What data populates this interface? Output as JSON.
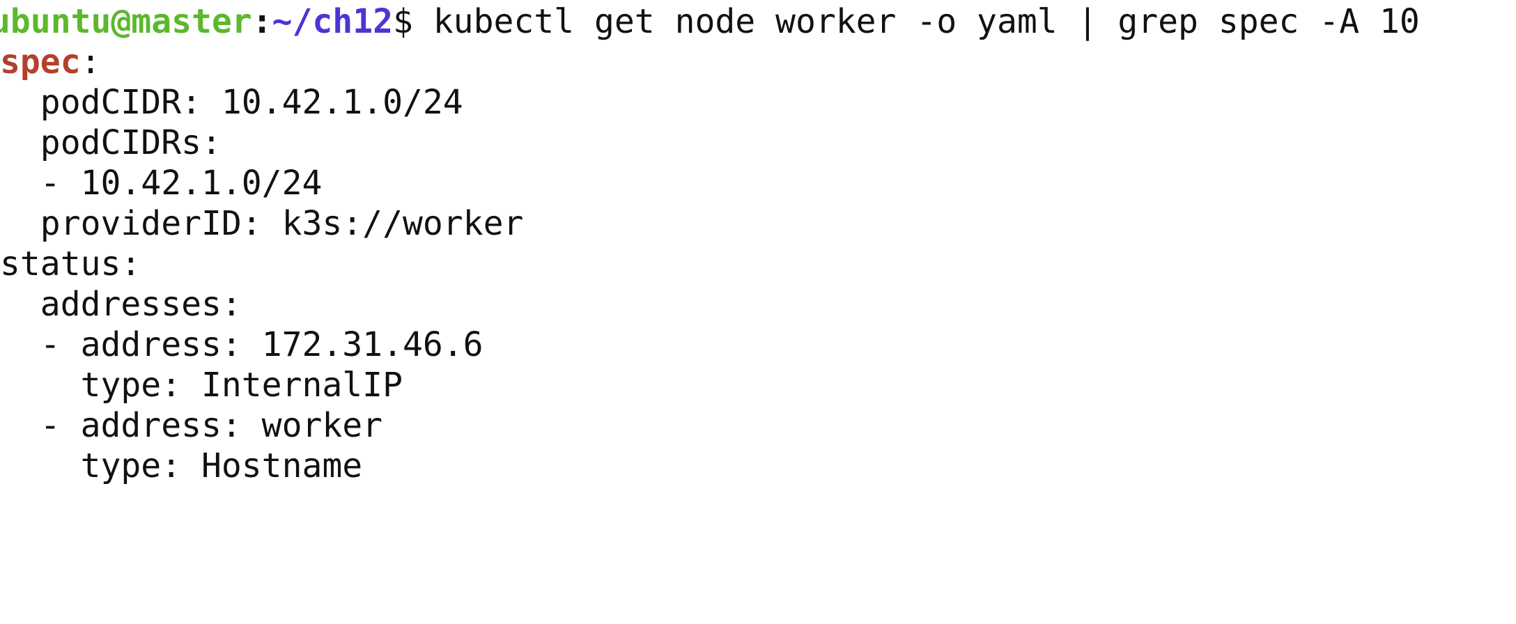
{
  "prompt": {
    "user_host": "ubuntu@master",
    "separator": ":",
    "path": "~/ch12",
    "symbol": "$ ",
    "command": "kubectl get node worker -o yaml | grep spec -A 10"
  },
  "colors": {
    "user_host": "#5cb82c",
    "path": "#4b35d6",
    "grep_match": "#b2402f",
    "text": "#111111",
    "background": "#ffffff"
  },
  "output": {
    "spec_key": "spec",
    "spec_colon": ":",
    "lines": [
      "  podCIDR: 10.42.1.0/24",
      "  podCIDRs:",
      "  - 10.42.1.0/24",
      "  providerID: k3s://worker",
      "status:",
      "  addresses:",
      "  - address: 172.31.46.6",
      "    type: InternalIP",
      "  - address: worker",
      "    type: Hostname"
    ]
  }
}
